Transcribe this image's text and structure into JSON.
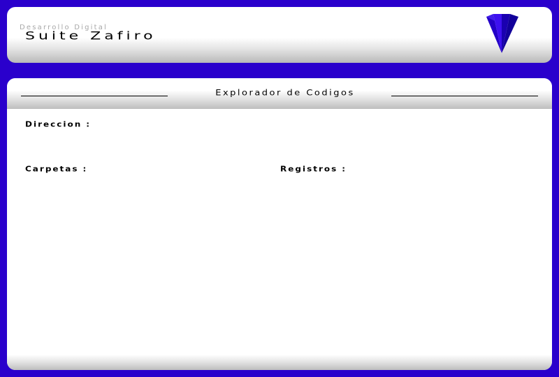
{
  "header": {
    "subtitle": "Desarrollo Digital",
    "title": "Suite Zafiro",
    "logo_icon": "sapphire-gem-icon"
  },
  "explorer": {
    "title": "Explorador de Codigos",
    "direccion_label": "Direccion",
    "carpetas_label": "Carpetas",
    "registros_label": "Registros",
    "separator": ":"
  },
  "colors": {
    "background": "#2a00cc",
    "gem": "#1a00d8"
  }
}
